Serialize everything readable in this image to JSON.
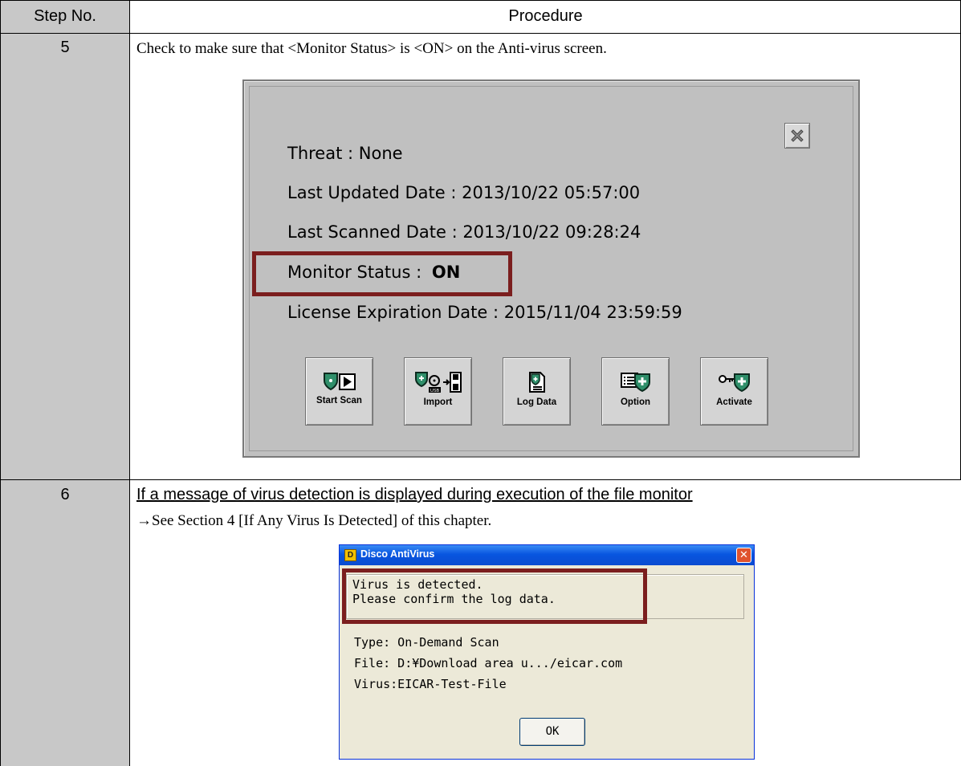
{
  "table": {
    "header_step": "Step No.",
    "header_procedure": "Procedure"
  },
  "rows": [
    {
      "step": "5",
      "text": "Check to make sure that <Monitor Status> is <ON> on the Anti-virus screen."
    },
    {
      "step": "6",
      "heading": "If a message of virus detection is displayed during execution of the file monitor",
      "text": "→See Section 4 [If Any Virus Is Detected] of this chapter."
    }
  ],
  "antivirus_panel": {
    "threat": "Threat : None",
    "last_updated": "Last Updated Date : 2013/10/22 05:57:00",
    "last_scanned": "Last Scanned Date : 2013/10/22 09:28:24",
    "monitor_status_label": "Monitor Status :",
    "monitor_status_value": "ON",
    "license_expiration": "License Expiration Date : 2015/11/04 23:59:59",
    "buttons": [
      {
        "label": "Start Scan",
        "icon": "shield-play-icon"
      },
      {
        "label": "Import",
        "icon": "usb-import-icon"
      },
      {
        "label": "Log Data",
        "icon": "log-document-icon"
      },
      {
        "label": "Option",
        "icon": "option-list-shield-icon"
      },
      {
        "label": "Activate",
        "icon": "key-shield-icon"
      }
    ],
    "highlight_color": "#7b1e1e"
  },
  "dialog": {
    "title": "Disco AntiVirus",
    "message_line1": "Virus is detected.",
    "message_line2": "Please confirm the log data.",
    "type": "Type: On-Demand Scan",
    "file": "File: D:¥Download area u.../eicar.com",
    "virus": "Virus:EICAR-Test-File",
    "ok_label": "OK"
  }
}
